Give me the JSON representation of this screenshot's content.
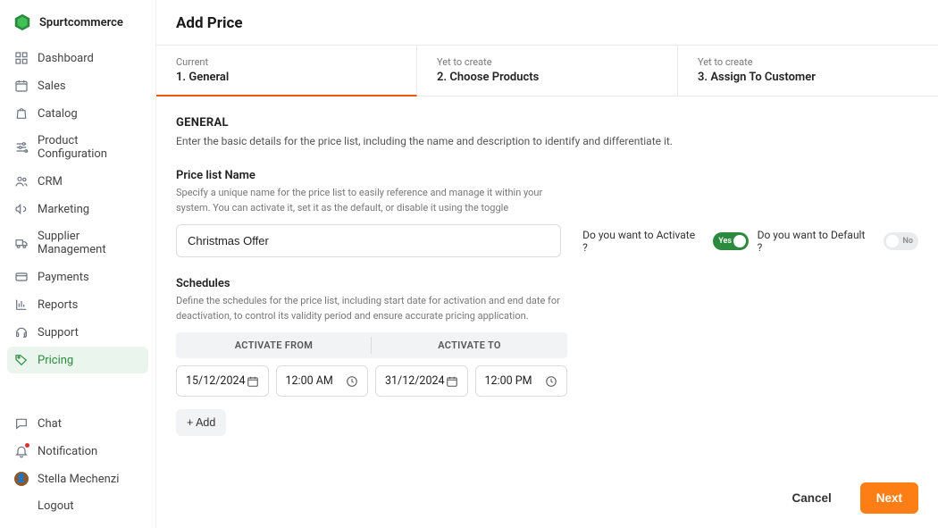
{
  "brand": {
    "name": "Spurtcommerce"
  },
  "sidebar": {
    "items": [
      {
        "label": "Dashboard",
        "icon": "grid"
      },
      {
        "label": "Sales",
        "icon": "calendar"
      },
      {
        "label": "Catalog",
        "icon": "bag"
      },
      {
        "label": "Product Configuration",
        "icon": "sliders"
      },
      {
        "label": "CRM",
        "icon": "users"
      },
      {
        "label": "Marketing",
        "icon": "megaphone"
      },
      {
        "label": "Supplier Management",
        "icon": "truck"
      },
      {
        "label": "Payments",
        "icon": "card"
      },
      {
        "label": "Reports",
        "icon": "chart"
      },
      {
        "label": "Support",
        "icon": "headset"
      },
      {
        "label": "Pricing",
        "icon": "tag"
      }
    ],
    "bottom": {
      "chat": "Chat",
      "notification": "Notification",
      "user": "Stella Mechenzi",
      "logout": "Logout"
    }
  },
  "header": {
    "title": "Add Price"
  },
  "tabs": [
    {
      "status": "Current",
      "label": "1. General"
    },
    {
      "status": "Yet to create",
      "label": "2. Choose Products"
    },
    {
      "status": "Yet to create",
      "label": "3. Assign To Customer"
    }
  ],
  "general": {
    "title": "GENERAL",
    "desc": "Enter the basic details for the price list, including the name and description to identify and differentiate it."
  },
  "priceListName": {
    "label": "Price list Name",
    "hint": "Specify a unique name for the price list to easily reference and manage it within your system. You can activate it, set it as the default, or disable it using the toggle",
    "value": "Christmas Offer"
  },
  "activate": {
    "label": "Do you want to Activate ?",
    "text": "Yes"
  },
  "defaultToggle": {
    "label": "Do you want to Default ?",
    "text": "No"
  },
  "schedules": {
    "label": "Schedules",
    "hint": "Define the schedules for the price list, including start date for activation and end date for deactivation, to control its validity period and ensure accurate pricing application.",
    "head": {
      "from": "ACTIVATE FROM",
      "to": "ACTIVATE TO"
    },
    "rows": [
      {
        "fromDate": "15/12/2024",
        "fromTime": "12:00 AM",
        "toDate": "31/12/2024",
        "toTime": "12:00 PM"
      }
    ],
    "addLabel": "+ Add"
  },
  "footer": {
    "cancel": "Cancel",
    "next": "Next"
  }
}
